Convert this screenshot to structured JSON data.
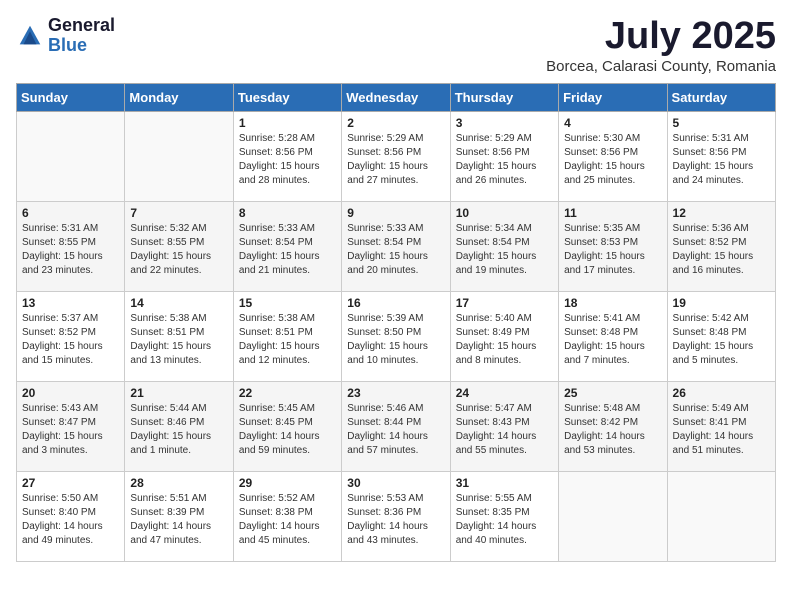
{
  "logo": {
    "general": "General",
    "blue": "Blue"
  },
  "title": "July 2025",
  "location": "Borcea, Calarasi County, Romania",
  "days_of_week": [
    "Sunday",
    "Monday",
    "Tuesday",
    "Wednesday",
    "Thursday",
    "Friday",
    "Saturday"
  ],
  "weeks": [
    [
      {
        "day": "",
        "info": ""
      },
      {
        "day": "",
        "info": ""
      },
      {
        "day": "1",
        "sunrise": "Sunrise: 5:28 AM",
        "sunset": "Sunset: 8:56 PM",
        "daylight": "Daylight: 15 hours and 28 minutes."
      },
      {
        "day": "2",
        "sunrise": "Sunrise: 5:29 AM",
        "sunset": "Sunset: 8:56 PM",
        "daylight": "Daylight: 15 hours and 27 minutes."
      },
      {
        "day": "3",
        "sunrise": "Sunrise: 5:29 AM",
        "sunset": "Sunset: 8:56 PM",
        "daylight": "Daylight: 15 hours and 26 minutes."
      },
      {
        "day": "4",
        "sunrise": "Sunrise: 5:30 AM",
        "sunset": "Sunset: 8:56 PM",
        "daylight": "Daylight: 15 hours and 25 minutes."
      },
      {
        "day": "5",
        "sunrise": "Sunrise: 5:31 AM",
        "sunset": "Sunset: 8:56 PM",
        "daylight": "Daylight: 15 hours and 24 minutes."
      }
    ],
    [
      {
        "day": "6",
        "sunrise": "Sunrise: 5:31 AM",
        "sunset": "Sunset: 8:55 PM",
        "daylight": "Daylight: 15 hours and 23 minutes."
      },
      {
        "day": "7",
        "sunrise": "Sunrise: 5:32 AM",
        "sunset": "Sunset: 8:55 PM",
        "daylight": "Daylight: 15 hours and 22 minutes."
      },
      {
        "day": "8",
        "sunrise": "Sunrise: 5:33 AM",
        "sunset": "Sunset: 8:54 PM",
        "daylight": "Daylight: 15 hours and 21 minutes."
      },
      {
        "day": "9",
        "sunrise": "Sunrise: 5:33 AM",
        "sunset": "Sunset: 8:54 PM",
        "daylight": "Daylight: 15 hours and 20 minutes."
      },
      {
        "day": "10",
        "sunrise": "Sunrise: 5:34 AM",
        "sunset": "Sunset: 8:54 PM",
        "daylight": "Daylight: 15 hours and 19 minutes."
      },
      {
        "day": "11",
        "sunrise": "Sunrise: 5:35 AM",
        "sunset": "Sunset: 8:53 PM",
        "daylight": "Daylight: 15 hours and 17 minutes."
      },
      {
        "day": "12",
        "sunrise": "Sunrise: 5:36 AM",
        "sunset": "Sunset: 8:52 PM",
        "daylight": "Daylight: 15 hours and 16 minutes."
      }
    ],
    [
      {
        "day": "13",
        "sunrise": "Sunrise: 5:37 AM",
        "sunset": "Sunset: 8:52 PM",
        "daylight": "Daylight: 15 hours and 15 minutes."
      },
      {
        "day": "14",
        "sunrise": "Sunrise: 5:38 AM",
        "sunset": "Sunset: 8:51 PM",
        "daylight": "Daylight: 15 hours and 13 minutes."
      },
      {
        "day": "15",
        "sunrise": "Sunrise: 5:38 AM",
        "sunset": "Sunset: 8:51 PM",
        "daylight": "Daylight: 15 hours and 12 minutes."
      },
      {
        "day": "16",
        "sunrise": "Sunrise: 5:39 AM",
        "sunset": "Sunset: 8:50 PM",
        "daylight": "Daylight: 15 hours and 10 minutes."
      },
      {
        "day": "17",
        "sunrise": "Sunrise: 5:40 AM",
        "sunset": "Sunset: 8:49 PM",
        "daylight": "Daylight: 15 hours and 8 minutes."
      },
      {
        "day": "18",
        "sunrise": "Sunrise: 5:41 AM",
        "sunset": "Sunset: 8:48 PM",
        "daylight": "Daylight: 15 hours and 7 minutes."
      },
      {
        "day": "19",
        "sunrise": "Sunrise: 5:42 AM",
        "sunset": "Sunset: 8:48 PM",
        "daylight": "Daylight: 15 hours and 5 minutes."
      }
    ],
    [
      {
        "day": "20",
        "sunrise": "Sunrise: 5:43 AM",
        "sunset": "Sunset: 8:47 PM",
        "daylight": "Daylight: 15 hours and 3 minutes."
      },
      {
        "day": "21",
        "sunrise": "Sunrise: 5:44 AM",
        "sunset": "Sunset: 8:46 PM",
        "daylight": "Daylight: 15 hours and 1 minute."
      },
      {
        "day": "22",
        "sunrise": "Sunrise: 5:45 AM",
        "sunset": "Sunset: 8:45 PM",
        "daylight": "Daylight: 14 hours and 59 minutes."
      },
      {
        "day": "23",
        "sunrise": "Sunrise: 5:46 AM",
        "sunset": "Sunset: 8:44 PM",
        "daylight": "Daylight: 14 hours and 57 minutes."
      },
      {
        "day": "24",
        "sunrise": "Sunrise: 5:47 AM",
        "sunset": "Sunset: 8:43 PM",
        "daylight": "Daylight: 14 hours and 55 minutes."
      },
      {
        "day": "25",
        "sunrise": "Sunrise: 5:48 AM",
        "sunset": "Sunset: 8:42 PM",
        "daylight": "Daylight: 14 hours and 53 minutes."
      },
      {
        "day": "26",
        "sunrise": "Sunrise: 5:49 AM",
        "sunset": "Sunset: 8:41 PM",
        "daylight": "Daylight: 14 hours and 51 minutes."
      }
    ],
    [
      {
        "day": "27",
        "sunrise": "Sunrise: 5:50 AM",
        "sunset": "Sunset: 8:40 PM",
        "daylight": "Daylight: 14 hours and 49 minutes."
      },
      {
        "day": "28",
        "sunrise": "Sunrise: 5:51 AM",
        "sunset": "Sunset: 8:39 PM",
        "daylight": "Daylight: 14 hours and 47 minutes."
      },
      {
        "day": "29",
        "sunrise": "Sunrise: 5:52 AM",
        "sunset": "Sunset: 8:38 PM",
        "daylight": "Daylight: 14 hours and 45 minutes."
      },
      {
        "day": "30",
        "sunrise": "Sunrise: 5:53 AM",
        "sunset": "Sunset: 8:36 PM",
        "daylight": "Daylight: 14 hours and 43 minutes."
      },
      {
        "day": "31",
        "sunrise": "Sunrise: 5:55 AM",
        "sunset": "Sunset: 8:35 PM",
        "daylight": "Daylight: 14 hours and 40 minutes."
      },
      {
        "day": "",
        "info": ""
      },
      {
        "day": "",
        "info": ""
      }
    ]
  ]
}
